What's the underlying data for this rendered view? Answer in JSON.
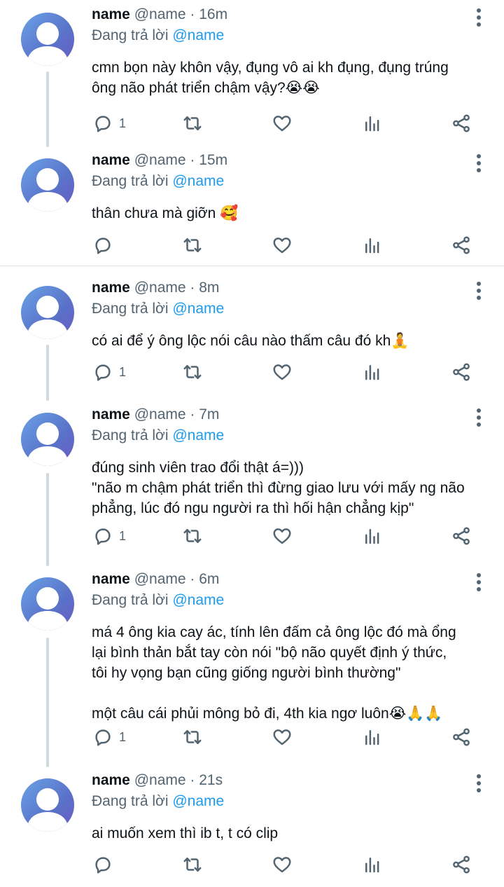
{
  "reply_prefix": "Đang trả lời",
  "tweets": [
    {
      "name": "name",
      "handle": "@name",
      "sep": "·",
      "time": "16m",
      "reply_to": "@name",
      "text": "cmn bọn này khôn vậy, đụng vô ai kh đụng, đụng trúng\nông não phát triển chậm vậy?😭😭",
      "reply_count": "1"
    },
    {
      "name": "name",
      "handle": "@name",
      "sep": "·",
      "time": "15m",
      "reply_to": "@name",
      "text": "thân chưa mà giỡn 🥰",
      "reply_count": ""
    },
    {
      "name": "name",
      "handle": "@name",
      "sep": "·",
      "time": "8m",
      "reply_to": "@name",
      "text": "có ai để ý ông lộc nói câu nào thấm câu đó kh🧘",
      "reply_count": "1"
    },
    {
      "name": "name",
      "handle": "@name",
      "sep": "·",
      "time": "7m",
      "reply_to": "@name",
      "text": "đúng sinh viên trao đổi thật á=)))\n\"não m chậm phát triển thì đừng giao lưu với mấy ng não\nphẳng, lúc đó ngu người ra thì hối hận chẳng kịp\"",
      "reply_count": "1"
    },
    {
      "name": "name",
      "handle": "@name",
      "sep": "·",
      "time": "6m",
      "reply_to": "@name",
      "text": "má 4 ông kia cay ác, tính lên đấm cả ông lộc đó mà ổng\nlại bình thản bắt tay còn nói \"bộ não quyết định ý thức,\ntôi hy vọng bạn cũng giống người bình thường\"\n\nmột câu cái phủi mông bỏ đi, 4th kia ngơ luôn😭🙏🙏",
      "reply_count": "1"
    },
    {
      "name": "name",
      "handle": "@name",
      "sep": "·",
      "time": "21s",
      "reply_to": "@name",
      "text": "ai muốn xem thì ib t, t có clip",
      "reply_count": ""
    }
  ],
  "icons": {
    "avatar": "default-avatar-icon",
    "more": "more-vertical-icon",
    "reply": "reply-icon",
    "retweet": "retweet-icon",
    "like": "heart-icon",
    "analytics": "analytics-icon",
    "share": "share-icon"
  },
  "colors": {
    "text": "#0f1419",
    "secondary": "#536471",
    "mention": "#1d9bf0",
    "thread_line": "#cfd9de",
    "divider": "#e3e7ea",
    "avatar_gradient": [
      "#6aa2e6",
      "#5a72c8",
      "#6a5bc4"
    ]
  }
}
